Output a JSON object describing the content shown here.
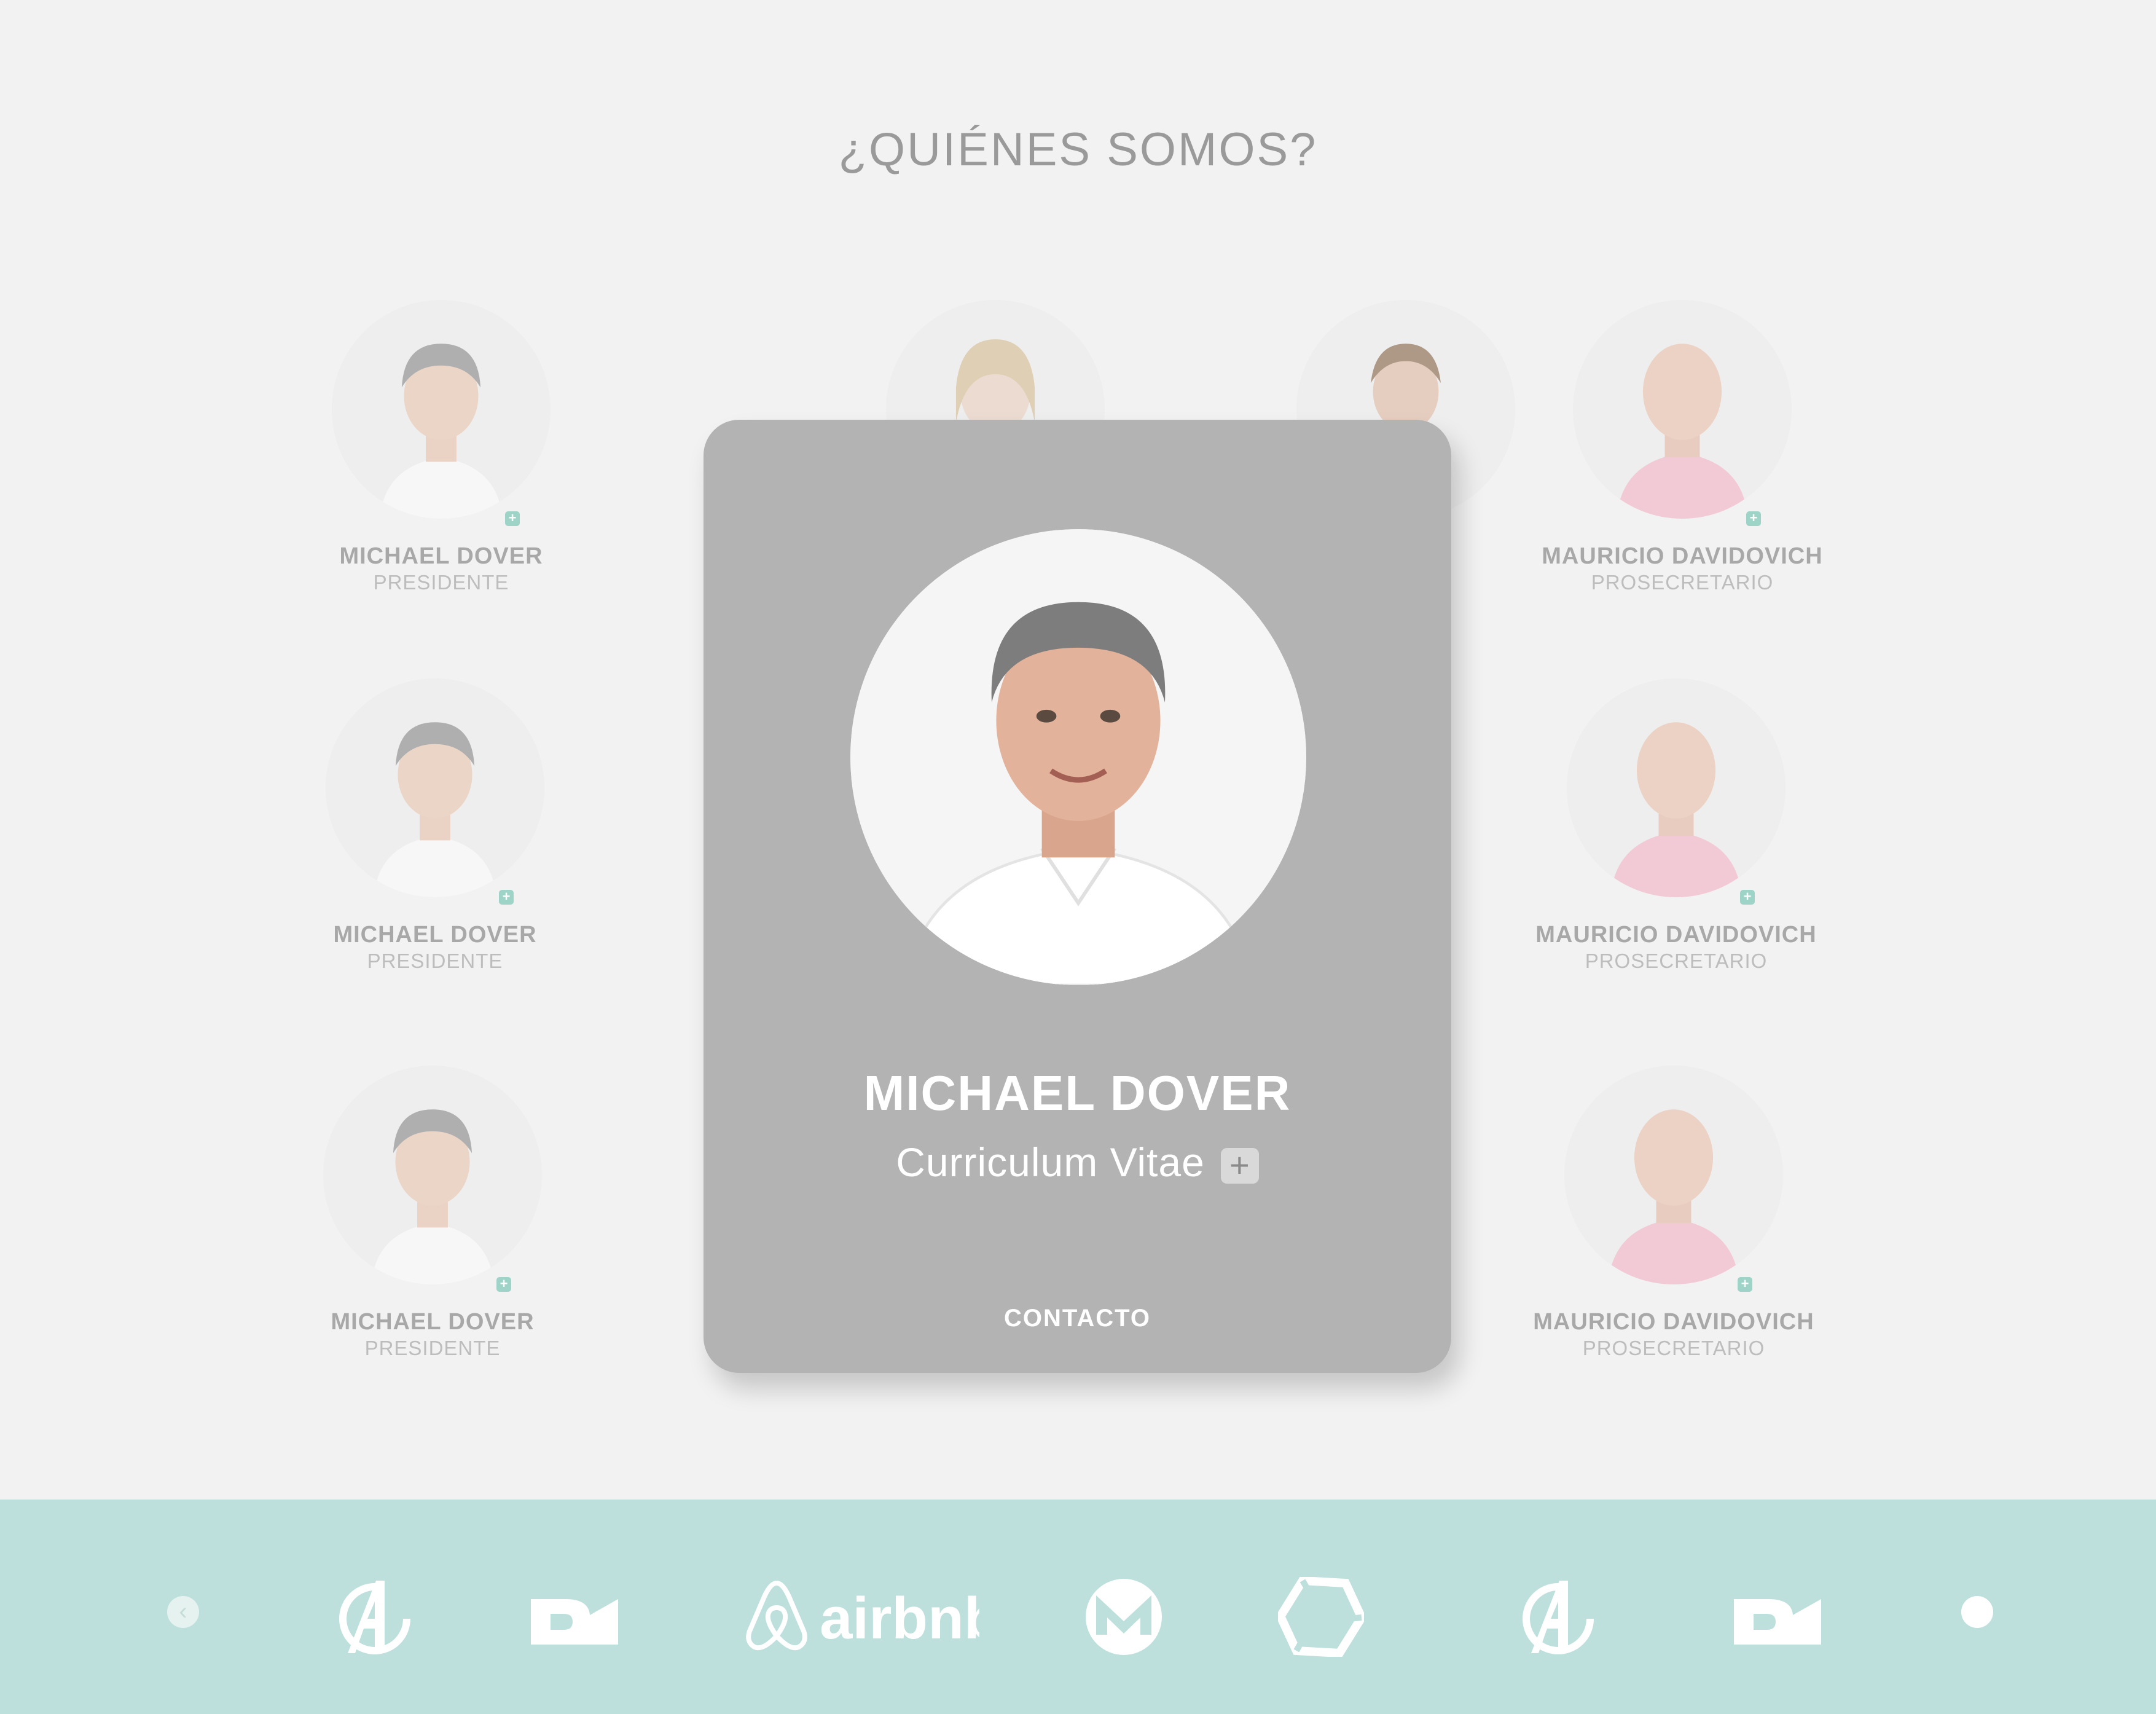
{
  "section": {
    "title": "¿QUIÉNES SOMOS?"
  },
  "members": [
    {
      "name": "MICHAEL DOVER",
      "role": "PRESIDENTE"
    },
    {
      "name": "MICHAEL DOVER",
      "role": "PRESIDENTE"
    },
    {
      "name": "MICHAEL DOVER",
      "role": "PRESIDENTE"
    },
    {
      "name": "MAURICIO DAVIDOVICH",
      "role": "PROSECRETARIO"
    },
    {
      "name": "MAURICIO DAVIDOVICH",
      "role": "PROSECRETARIO"
    },
    {
      "name": "MAURICIO DAVIDOVICH",
      "role": "PROSECRETARIO"
    }
  ],
  "modal": {
    "name": "MICHAEL DOVER",
    "cv_label": "Curriculum Vitae",
    "cv_icon": "+",
    "contact_label": "CONTACTO"
  },
  "carousel": {
    "prev_icon": "‹",
    "logos": [
      "avengers-logo",
      "directv-logo",
      "airbnb-logo",
      "monero-logo",
      "polygon-logo",
      "avengers-logo",
      "directv-logo"
    ],
    "airbnb_text": "airbnb"
  },
  "colors": {
    "accent": "#bde0dd",
    "badge": "#9ed3c7",
    "modal": "#b3b3b3"
  }
}
